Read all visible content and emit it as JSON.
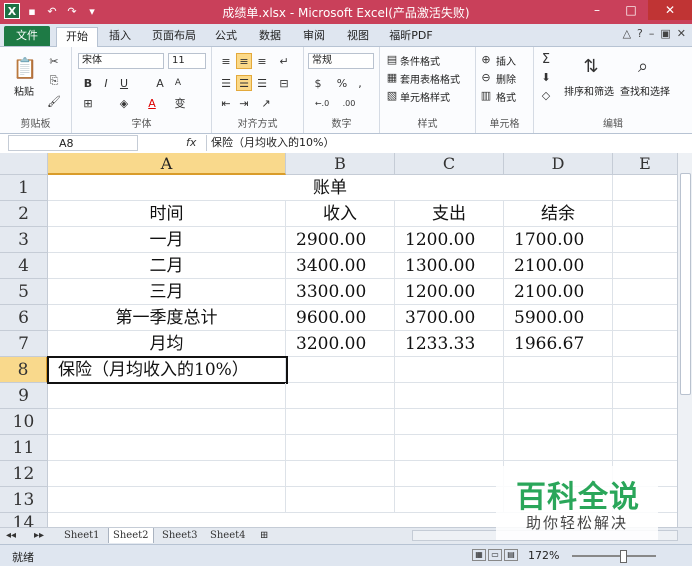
{
  "window": {
    "title": "成绩单.xlsx - Microsoft Excel(产品激活失败)",
    "accent": "#c9405a"
  },
  "tabs": [
    {
      "label": "文件"
    },
    {
      "label": "开始"
    },
    {
      "label": "插入"
    },
    {
      "label": "页面布局"
    },
    {
      "label": "公式"
    },
    {
      "label": "数据"
    },
    {
      "label": "审阅"
    },
    {
      "label": "视图"
    },
    {
      "label": "福昕PDF"
    }
  ],
  "ribbon": {
    "clipboard": {
      "label": "剪贴板",
      "paste": "粘贴"
    },
    "font": {
      "label": "字体",
      "name": "宋体",
      "size": "11",
      "bold": "B",
      "italic": "I",
      "underline": "U",
      "grow": "A",
      "shrink": "A",
      "color": "A",
      "wen": "变"
    },
    "alignment": {
      "label": "对齐方式"
    },
    "number": {
      "label": "数字",
      "format": "常规",
      "percent": "%",
      "comma": ",",
      "inc": "←.0",
      "dec": ".00"
    },
    "styles": {
      "label": "样式",
      "conditional": "条件格式",
      "table": "套用表格格式",
      "cell": "单元格样式"
    },
    "cells": {
      "label": "单元格",
      "insert": "插入",
      "delete": "删除",
      "format": "格式"
    },
    "editing": {
      "label": "编辑",
      "sort": "排序和筛选",
      "find": "查找和选择",
      "sigma": "Σ"
    }
  },
  "formula_bar": {
    "name_box": "A8",
    "fx": "fx",
    "content": "保险（月均收入的10%）"
  },
  "columns": [
    "A",
    "B",
    "C",
    "D",
    "E"
  ],
  "rows": [
    "1",
    "2",
    "3",
    "4",
    "5",
    "6",
    "7",
    "8",
    "9",
    "10",
    "11",
    "12",
    "13",
    "14"
  ],
  "cells": {
    "r1": {
      "title": "账单"
    },
    "r2": [
      "时间",
      "收入",
      "支出",
      "结余"
    ],
    "r3": [
      "一月",
      "2900.00",
      "1200.00",
      "1700.00"
    ],
    "r4": [
      "二月",
      "3400.00",
      "1300.00",
      "2100.00"
    ],
    "r5": [
      "三月",
      "3300.00",
      "1200.00",
      "2100.00"
    ],
    "r6": [
      "第一季度总计",
      "9600.00",
      "3700.00",
      "5900.00"
    ],
    "r7": [
      "月均",
      "3200.00",
      "1233.33",
      "1966.67"
    ],
    "r8": [
      "保险（月均收入的10%）",
      "",
      "",
      ""
    ]
  },
  "sheets": [
    "Sheet1",
    "Sheet2",
    "Sheet3",
    "Sheet4"
  ],
  "status": {
    "ready": "就绪",
    "zoom": "172%"
  },
  "watermark": {
    "title": "百科全说",
    "subtitle": "助你轻松解决"
  }
}
